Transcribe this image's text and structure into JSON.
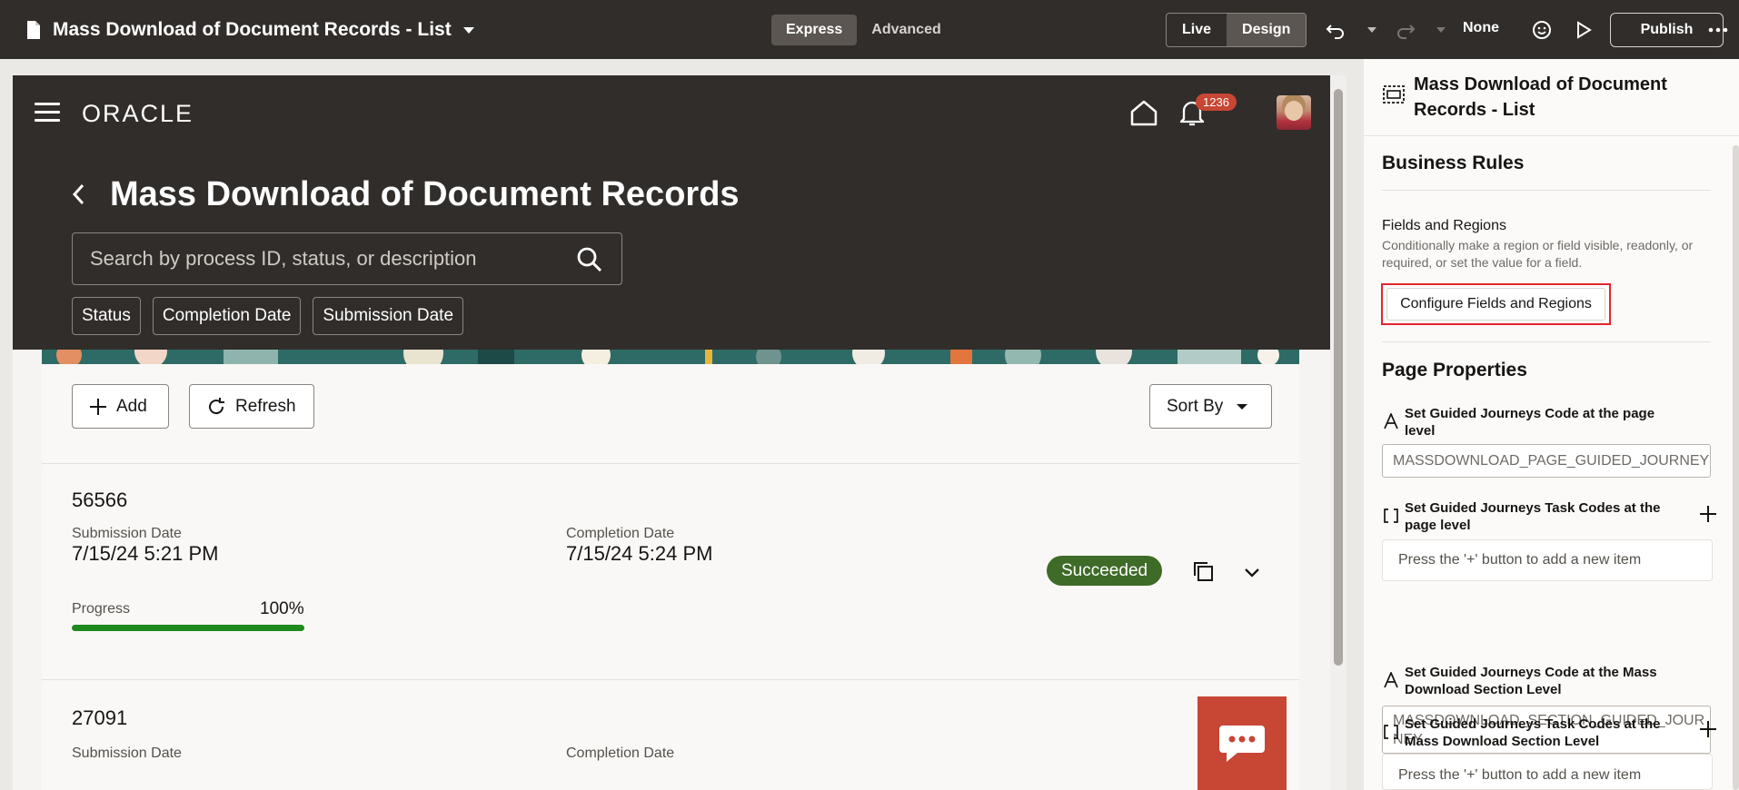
{
  "builder": {
    "app_title": "Mass Download of Document Records - List",
    "modes": [
      "Express",
      "Advanced"
    ],
    "active_mode": "Express",
    "views": [
      "Live",
      "Design"
    ],
    "active_view": "Design",
    "none_label": "None",
    "publish_label": "Publish"
  },
  "app": {
    "logo": "ORACLE",
    "notification_count": "1236",
    "page_title": "Mass Download of Document Records",
    "search_placeholder": "Search by process ID, status, or description",
    "filters": [
      "Status",
      "Completion Date",
      "Submission Date"
    ],
    "toolbar": {
      "add_label": "Add",
      "refresh_label": "Refresh",
      "sort_label": "Sort By"
    },
    "records": [
      {
        "id": "56566",
        "submission_label": "Submission Date",
        "submission_value": "7/15/24 5:21 PM",
        "completion_label": "Completion Date",
        "completion_value": "7/15/24 5:24 PM",
        "progress_label": "Progress",
        "progress_value": "100%",
        "progress_fraction": 1.0,
        "status": "Succeeded"
      },
      {
        "id": "27091",
        "submission_label": "Submission Date",
        "completion_label": "Completion Date"
      }
    ]
  },
  "panel": {
    "title": "Mass Download of Document Records - List",
    "business_rules": {
      "heading": "Business Rules",
      "fields_heading": "Fields and Regions",
      "fields_help": "Conditionally make a region or field visible, readonly, or required, or set the value for a field.",
      "configure_label": "Configure Fields and Regions"
    },
    "page_properties": {
      "heading": "Page Properties",
      "props": [
        {
          "label": "Set Guided Journeys Code at the page level",
          "value": "MASSDOWNLOAD_PAGE_GUIDED_JOURNEY"
        },
        {
          "label": "Set Guided Journeys Task Codes at the page level",
          "empty_text": "Press the '+' button to add a new item"
        },
        {
          "label": "Set Guided Journeys Code at the Mass Download Section Level",
          "value": "MASSDOWNLOAD_SECTION_GUIDED_JOUR NEY"
        },
        {
          "label": "Set Guided Journeys Task Codes at the Mass Download Section Level",
          "empty_text": "Press the '+' button to add a new item"
        }
      ]
    }
  },
  "colors": {
    "header_bg": "#312d2a",
    "accent_red": "#c74634",
    "success_green": "#3e6b28",
    "highlight": "#e3262c"
  }
}
